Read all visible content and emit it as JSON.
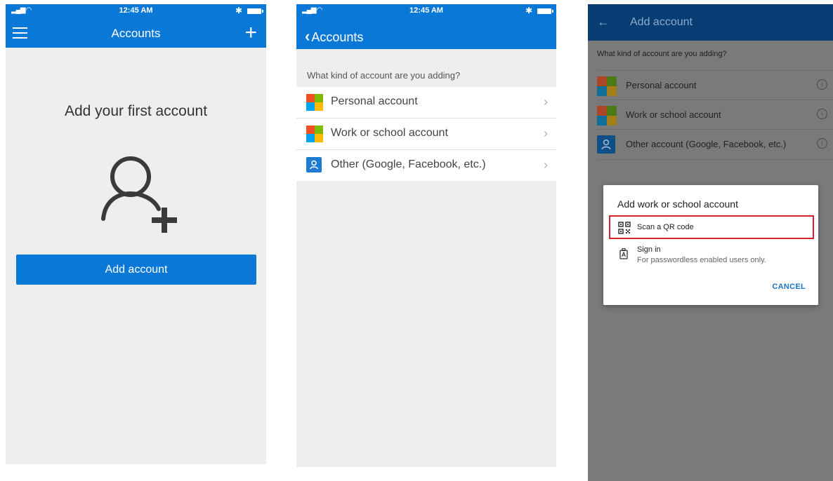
{
  "status": {
    "time": "12:45 AM"
  },
  "screen1": {
    "title": "Accounts",
    "headline": "Add your first account",
    "add_button": "Add account"
  },
  "screen2": {
    "back_label": "Accounts",
    "question": "What kind of account are you adding?",
    "items": [
      {
        "label": "Personal account",
        "icon": "microsoft-logo-icon"
      },
      {
        "label": "Work or school account",
        "icon": "microsoft-logo-icon"
      },
      {
        "label": "Other (Google, Facebook, etc.)",
        "icon": "person-icon"
      }
    ]
  },
  "screen3": {
    "title": "Add account",
    "question": "What kind of account are you adding?",
    "items": [
      {
        "label": "Personal account",
        "icon": "microsoft-logo-icon"
      },
      {
        "label": "Work or school account",
        "icon": "microsoft-logo-icon"
      },
      {
        "label": "Other account (Google, Facebook, etc.)",
        "icon": "person-icon"
      }
    ],
    "dialog": {
      "title": "Add work or school account",
      "scan_label": "Scan a QR code",
      "signin_label": "Sign in",
      "signin_sub": "For passwordless enabled users only.",
      "cancel": "CANCEL"
    }
  },
  "colors": {
    "accent": "#0a78d7",
    "highlight": "#d1232f"
  }
}
